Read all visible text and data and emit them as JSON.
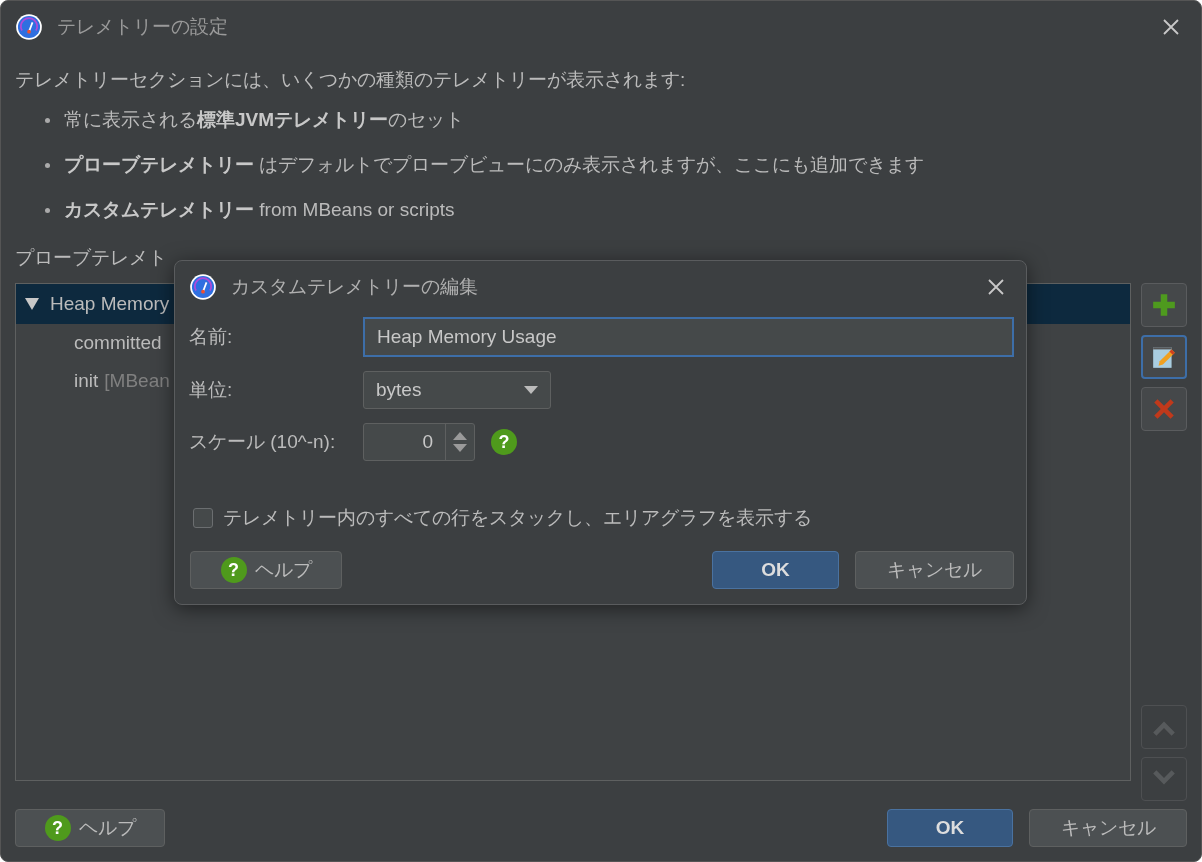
{
  "window": {
    "title": "テレメトリーの設定"
  },
  "intro": "テレメトリーセクションには、いくつかの種類のテレメトリーが表示されます:",
  "bullets": [
    "常に表示される**標準JVMテレメトリー**のセット",
    "**プローブテレメトリー** はデフォルトでプローブビューにのみ表示されますが、ここにも追加できます",
    "**カスタムテレメトリー** from MBeans or scripts"
  ],
  "list_label": "プローブテレメト",
  "tree": [
    {
      "label": "Heap Memory",
      "expanded": true,
      "selected": true,
      "children": [
        {
          "label": "committed"
        },
        {
          "label": "init",
          "suffix": "[MBean"
        }
      ]
    }
  ],
  "side_buttons": [
    {
      "kind": "add",
      "selected": false,
      "disabled": false
    },
    {
      "kind": "edit",
      "selected": true,
      "disabled": false
    },
    {
      "kind": "remove",
      "selected": false,
      "disabled": false
    },
    {
      "kind": "up",
      "selected": false,
      "disabled": true
    },
    {
      "kind": "down",
      "selected": false,
      "disabled": true
    }
  ],
  "footer": {
    "help": {
      "icon": "?",
      "label": "ヘルプ"
    },
    "ok": "OK",
    "cancel": "キャンセル"
  },
  "dialog": {
    "title": "カスタムテレメトリーの編集",
    "name": {
      "label": "名前:",
      "value": "Heap Memory Usage"
    },
    "unit": {
      "label": "単位:",
      "value": "bytes"
    },
    "scale": {
      "label": "スケール (10^-n):",
      "value": "0",
      "help_icon": "?"
    },
    "stack": {
      "label": "テレメトリー内のすべての行をスタックし、エリアグラフを表示する",
      "checked": false
    },
    "help": {
      "icon": "?",
      "label": "ヘルプ"
    },
    "ok": "OK",
    "cancel": "キャンセル"
  }
}
